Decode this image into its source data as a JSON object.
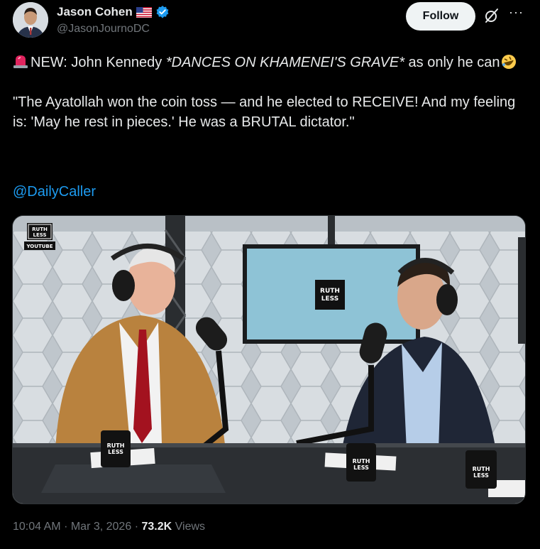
{
  "author": {
    "name": "Jason Cohen",
    "flag_icon": "us-flag-icon",
    "verified_icon": "verified-badge-icon",
    "handle": "@JasonJournoDC"
  },
  "actions": {
    "follow_label": "Follow",
    "grok_icon": "grok-icon",
    "more_label": "···"
  },
  "tweet": {
    "siren_icon": "siren-emoji",
    "lead": "NEW: John Kennedy ",
    "emphasis": "*DANCES ON KHAMENEI'S GRAVE*",
    "tail": " as only he can",
    "laugh_icon": "rolling-laughing-emoji",
    "quote": "\"The Ayatollah won the coin toss — and he elected to RECEIVE! And my feeling is: 'May he rest in pieces.' He was a BRUTAL dictator.\"",
    "mention": "@DailyCaller"
  },
  "media": {
    "logo_line1": "RUTH",
    "logo_line2": "LESS",
    "logo_caption": "YOUTUBE",
    "screen_logo_line1": "RUTH",
    "screen_logo_line2": "LESS",
    "mug_text_line1": "RUTH",
    "mug_text_line2": "LESS"
  },
  "meta": {
    "time": "10:04 AM",
    "date": "Mar 3, 2026",
    "views_count": "73.2K",
    "views_label": "Views",
    "separator": "·"
  },
  "colors": {
    "background": "#000000",
    "text": "#e7e9ea",
    "secondary": "#71767b",
    "link": "#1d9bf0",
    "verified": "#1d9bf0"
  }
}
